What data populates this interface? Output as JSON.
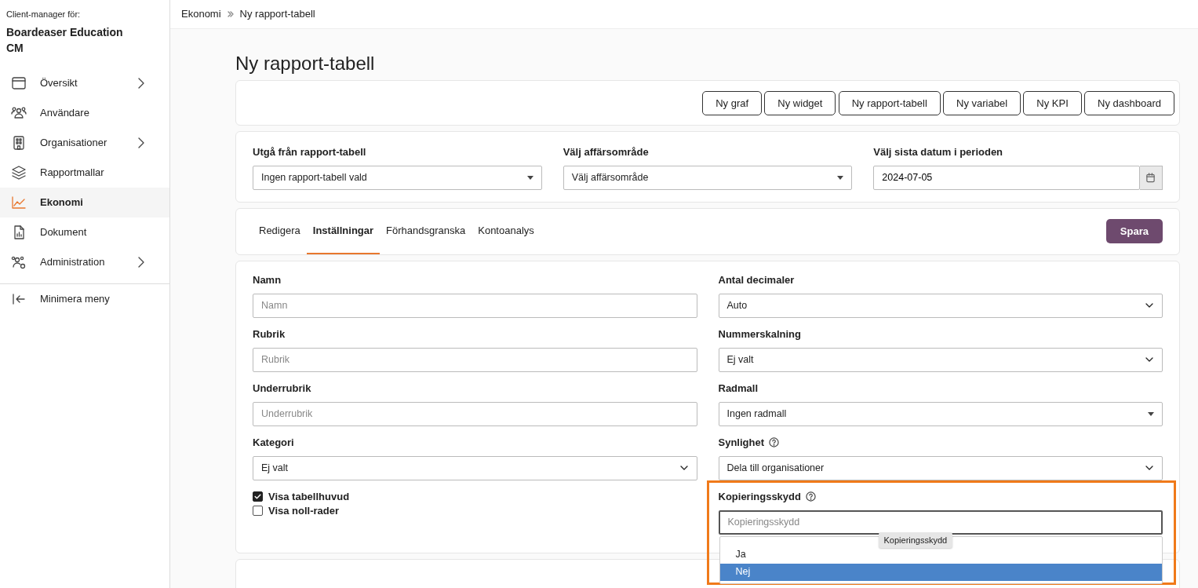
{
  "sidebar": {
    "caption": "Client-manager för:",
    "org_name": "Boardeaser Education CM",
    "items": [
      {
        "label": "Översikt",
        "selected": false,
        "expandable": true
      },
      {
        "label": "Användare",
        "selected": false,
        "expandable": false
      },
      {
        "label": "Organisationer",
        "selected": false,
        "expandable": true
      },
      {
        "label": "Rapportmallar",
        "selected": false,
        "expandable": false
      },
      {
        "label": "Ekonomi",
        "selected": true,
        "expandable": false
      },
      {
        "label": "Dokument",
        "selected": false,
        "expandable": false
      },
      {
        "label": "Administration",
        "selected": false,
        "expandable": true
      }
    ],
    "collapse_label": "Minimera meny"
  },
  "breadcrumb": [
    "Ekonomi",
    "Ny rapport-tabell"
  ],
  "page_title": "Ny rapport-tabell",
  "toolbar": {
    "buttons": [
      "Ny graf",
      "Ny widget",
      "Ny rapport-tabell",
      "Ny variabel",
      "Ny KPI",
      "Ny dashboard"
    ]
  },
  "filters": [
    {
      "kind": "select",
      "label": "Utgå från rapport-tabell",
      "value": "Ingen rapport-tabell vald"
    },
    {
      "kind": "select",
      "label": "Välj affärsområde",
      "value": "Välj affärsområde"
    },
    {
      "kind": "date",
      "label": "Välj sista datum i perioden",
      "value": "2024-07-05"
    }
  ],
  "tabs": [
    {
      "label": "Redigera",
      "selected": false
    },
    {
      "label": "Inställningar",
      "selected": true
    },
    {
      "label": "Förhandsgranska",
      "selected": false
    },
    {
      "label": "Kontoanalys",
      "selected": false
    }
  ],
  "save_button": "Spara",
  "form": {
    "left": [
      {
        "kind": "text",
        "label": "Namn",
        "placeholder": "Namn"
      },
      {
        "kind": "text",
        "label": "Rubrik",
        "placeholder": "Rubrik"
      },
      {
        "kind": "text",
        "label": "Underrubrik",
        "placeholder": "Underrubrik"
      },
      {
        "kind": "select",
        "label": "Kategori",
        "value": "Ej valt"
      }
    ],
    "checkboxes": [
      {
        "label": "Visa tabellhuvud",
        "checked": true
      },
      {
        "label": "Visa noll-rader",
        "checked": false
      }
    ],
    "right": [
      {
        "kind": "select",
        "label": "Antal decimaler",
        "value": "Auto",
        "help": false
      },
      {
        "kind": "select",
        "label": "Nummerskalning",
        "value": "Ej valt",
        "help": false
      },
      {
        "kind": "combo",
        "label": "Radmall",
        "value": "Ingen radmall",
        "help": false
      },
      {
        "kind": "select",
        "label": "Synlighet",
        "value": "Dela till organisationer",
        "help": true
      }
    ],
    "copy_protection": {
      "label": "Kopieringsskydd",
      "help": true,
      "placeholder": "Kopieringsskydd",
      "tooltip": "Kopieringsskydd",
      "options": [
        {
          "label": "Ja",
          "selected": false
        },
        {
          "label": "Nej",
          "selected": true
        }
      ]
    }
  }
}
